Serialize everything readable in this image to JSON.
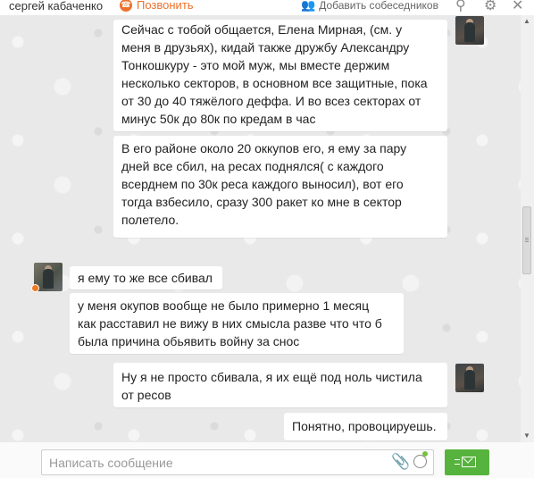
{
  "header": {
    "contact_name": "сергей кабаченко",
    "call_label": "Позвонить",
    "add_participants_label": "Добавить собеседников"
  },
  "messages": [
    {
      "direction": "outgoing",
      "lines": [
        "Сейчас с тобой общается, Елена Мирная, (см. у",
        "меня в друзьях), кидай также дружбу Александру",
        "Тонкошкуру - это мой муж, мы вместе держим",
        "несколько секторов, в основном все защитные, пока",
        "от 30 до 40 тяжёлого деффа. И во всез секторах от",
        "минус 50к до 80к по кредам в час"
      ]
    },
    {
      "direction": "outgoing",
      "lines": [
        "В его районе около 20 оккупов его, я ему за пару",
        "дней все сбил, на ресах поднялся( с каждого",
        "всерднем по 30к реса каждого выносил), вот его",
        "тогда взбесило, сразу 300 ракет ко мне в сектор",
        "полетело."
      ]
    },
    {
      "direction": "incoming",
      "lines": [
        "я ему то же все сбивал"
      ]
    },
    {
      "direction": "incoming",
      "lines": [
        "у меня окупов вообще не было примерно 1 месяц",
        "как расставил не вижу в них смысла разве что что б",
        "была причина обьявить войну за снос"
      ]
    },
    {
      "direction": "outgoing",
      "lines": [
        "Ну я не просто сбивала, я их ещё под ноль чистила",
        "от ресов"
      ]
    },
    {
      "direction": "outgoing",
      "lines": [
        "Понятно, провоцируешь."
      ]
    }
  ],
  "compose": {
    "placeholder": "Написать сообщение"
  },
  "colors": {
    "accent": "#eb722e",
    "send_button": "#56b33d",
    "online_dot": "#f27a1f"
  }
}
